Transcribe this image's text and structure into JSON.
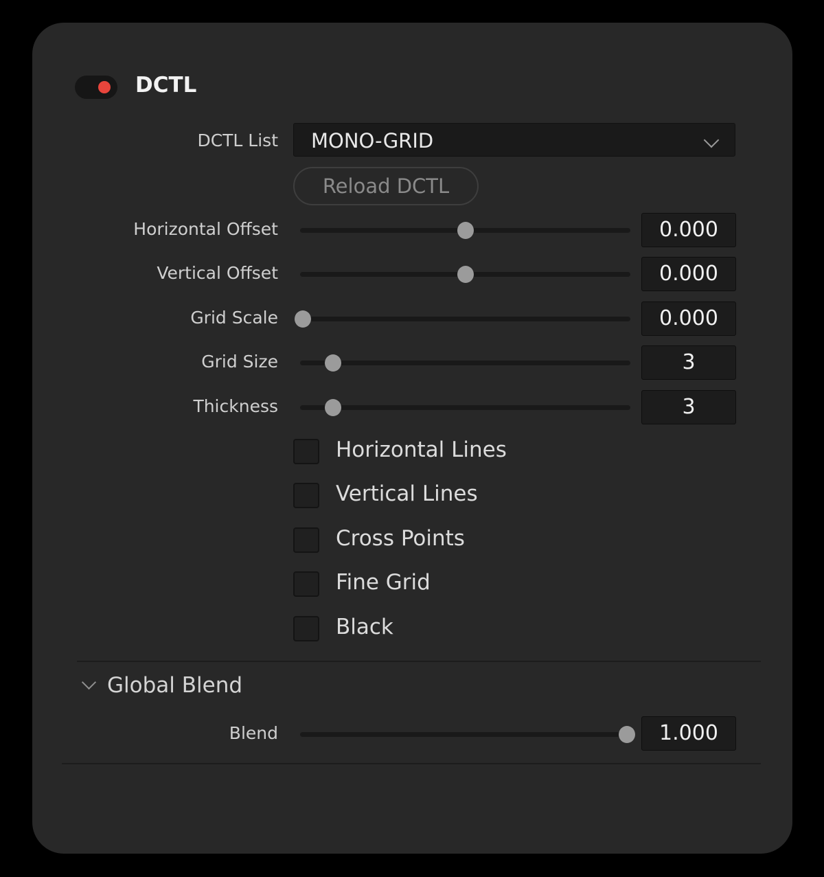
{
  "header": {
    "title": "DCTL",
    "enabled": true,
    "toggle_color": "#e8453c"
  },
  "dctl_list": {
    "label": "DCTL List",
    "selected": "MONO-GRID",
    "icon": "chevron-down-icon"
  },
  "reload_button": {
    "label": "Reload DCTL"
  },
  "sliders": [
    {
      "label": "Horizontal Offset",
      "value": "0.000",
      "position": 0.5
    },
    {
      "label": "Vertical Offset",
      "value": "0.000",
      "position": 0.5
    },
    {
      "label": "Grid Scale",
      "value": "0.000",
      "position": 0.0
    },
    {
      "label": "Grid Size",
      "value": "3",
      "position": 0.1
    },
    {
      "label": "Thickness",
      "value": "3",
      "position": 0.1
    }
  ],
  "checkboxes": [
    {
      "label": "Horizontal Lines",
      "checked": false
    },
    {
      "label": "Vertical Lines",
      "checked": false
    },
    {
      "label": "Cross Points",
      "checked": false
    },
    {
      "label": "Fine Grid",
      "checked": false
    },
    {
      "label": "Black",
      "checked": false
    }
  ],
  "global_blend": {
    "title": "Global Blend",
    "expanded": true,
    "blend": {
      "label": "Blend",
      "value": "1.000",
      "position": 0.99
    }
  }
}
